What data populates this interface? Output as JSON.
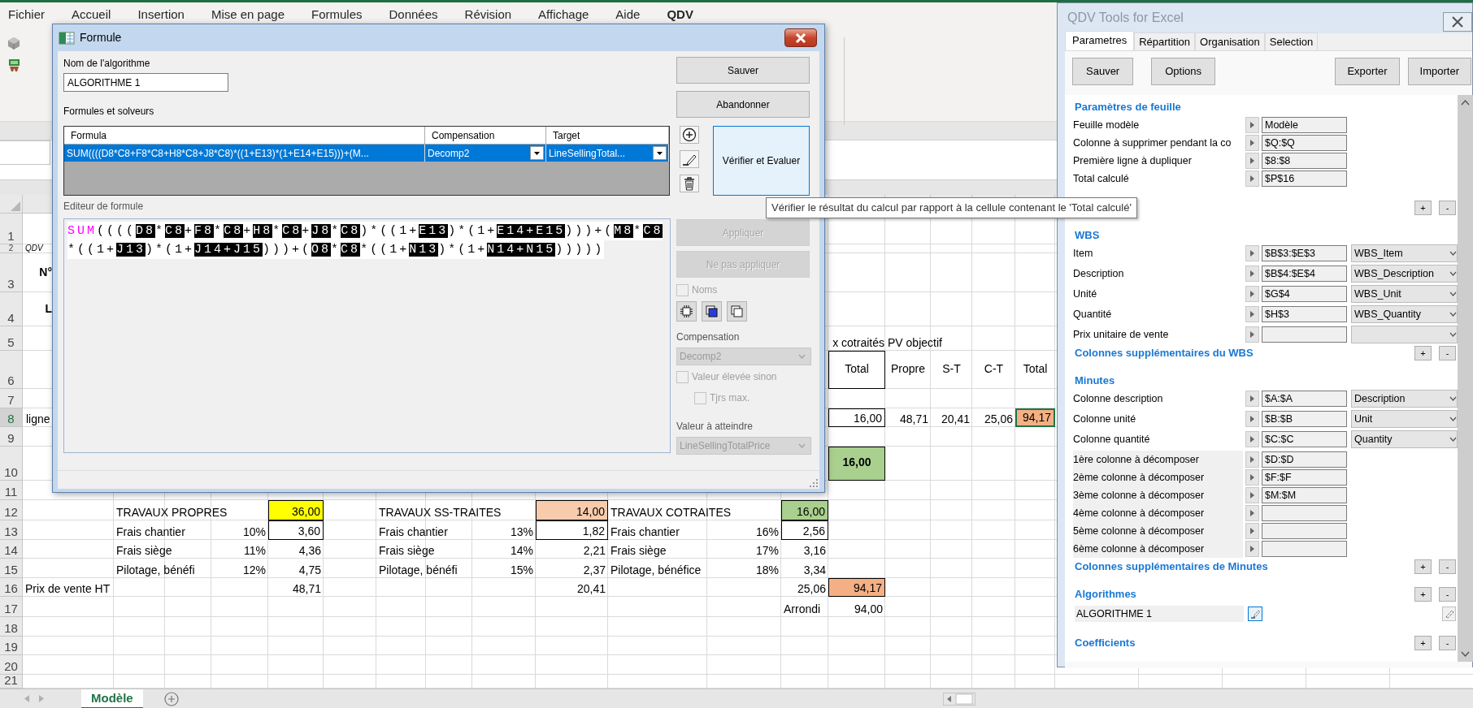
{
  "ribbon": {
    "tabs": [
      {
        "label": "Fichier",
        "selected": false
      },
      {
        "label": "Accueil",
        "selected": false
      },
      {
        "label": "Insertion",
        "selected": false
      },
      {
        "label": "Mise en page",
        "selected": false
      },
      {
        "label": "Formules",
        "selected": false
      },
      {
        "label": "Données",
        "selected": false
      },
      {
        "label": "Révision",
        "selected": false
      },
      {
        "label": "Affichage",
        "selected": false
      },
      {
        "label": "Aide",
        "selected": false
      },
      {
        "label": "QDV",
        "selected": true
      }
    ]
  },
  "sheet": {
    "row_numbers": [
      {
        "label": "1",
        "selected": false
      },
      {
        "label": "2",
        "selected": false
      },
      {
        "label": "3",
        "selected": false
      },
      {
        "label": "4",
        "selected": false
      },
      {
        "label": "5",
        "selected": false
      },
      {
        "label": "6",
        "selected": false
      },
      {
        "label": "7",
        "selected": false
      },
      {
        "label": "8",
        "selected": true
      },
      {
        "label": "9",
        "selected": false
      },
      {
        "label": "10",
        "selected": false
      },
      {
        "label": "11",
        "selected": false
      },
      {
        "label": "12",
        "selected": false
      },
      {
        "label": "13",
        "selected": false
      },
      {
        "label": "14",
        "selected": false
      },
      {
        "label": "15",
        "selected": false
      },
      {
        "label": "16",
        "selected": false
      },
      {
        "label": "17",
        "selected": false
      },
      {
        "label": "18",
        "selected": false
      },
      {
        "label": "19",
        "selected": false
      },
      {
        "label": "20",
        "selected": false
      },
      {
        "label": "21",
        "selected": false
      }
    ],
    "left_strip": [
      {
        "text": "QDV",
        "kind": "note"
      },
      {
        "text": "N°",
        "kind": "cut_bold"
      },
      {
        "text": "L",
        "kind": "cut_bold"
      },
      {
        "text": "ligne",
        "kind": "cut"
      }
    ],
    "objective": {
      "group_label": "x cotraités",
      "label": "PV objectif",
      "headers": [
        "Total",
        "Propre",
        "S-T",
        "C-T",
        "Total"
      ],
      "values": [
        {
          "text": "16,00",
          "selected": false
        },
        {
          "text": "48,71",
          "selected": false
        },
        {
          "text": "20,41",
          "selected": false
        },
        {
          "text": "25,06",
          "selected": false
        },
        {
          "text": "94,17",
          "color": "#f4b084",
          "selected": true
        }
      ],
      "total": {
        "text": "16,00",
        "color": "#a9d08e"
      }
    },
    "blocks": [
      {
        "title": "TRAVAUX PROPRES",
        "amount": {
          "text": "36,00",
          "color": "#ffff00"
        },
        "lines": [
          {
            "label": "Frais chantier",
            "rate": "10%",
            "value": "3,60"
          },
          {
            "label": "Frais siège",
            "rate": "11%",
            "value": "4,36"
          },
          {
            "label": "Pilotage, bénéfi",
            "rate": "12%",
            "value": "4,75"
          }
        ],
        "price": "48,71"
      },
      {
        "title": "TRAVAUX SS-TRAITES",
        "amount": {
          "text": "14,00",
          "color": "#f8cbad"
        },
        "lines": [
          {
            "label": "Frais chantier",
            "rate": "13%",
            "value": "1,82"
          },
          {
            "label": "Frais siège",
            "rate": "14%",
            "value": "2,21"
          },
          {
            "label": "Pilotage, bénéfi",
            "rate": "15%",
            "value": "2,37"
          }
        ],
        "price": "20,41"
      },
      {
        "title": "TRAVAUX COTRAITES",
        "amount": {
          "text": "16,00",
          "color": "#a9d08e"
        },
        "lines": [
          {
            "label": "Frais chantier",
            "rate": "16%",
            "value": "2,56"
          },
          {
            "label": "Frais siège",
            "rate": "17%",
            "value": "3,16"
          },
          {
            "label": "Pilotage, bénéfice",
            "rate": "18%",
            "value": "3,34"
          }
        ],
        "price": "25,06"
      }
    ],
    "price_label": "Prix de vente HT",
    "grand_total": {
      "text": "94,17",
      "color": "#f4b084"
    },
    "rounded": {
      "label": "Arrondi",
      "value": "94,00"
    },
    "sheet_tabs": [
      {
        "label": "Modèle",
        "selected": true
      }
    ]
  },
  "dialog": {
    "title": "Formule",
    "name_label": "Nom de l'algorithme",
    "name_value": "ALGORITHME 1",
    "formulas_label": "Formules et solveurs",
    "formula_grid": {
      "columns": [
        "Formula",
        "Compensation",
        "Target"
      ],
      "rows": [
        {
          "selected": true,
          "formula": "SUM((((D8*C8+F8*C8+H8*C8+J8*C8)*((1+E13)*(1+E14+E15)))+(M...",
          "compensation": "Decomp2",
          "target": "LineSellingTotal..."
        }
      ]
    },
    "actions": [
      {
        "label": "Sauver"
      },
      {
        "label": "Abandonner"
      }
    ],
    "verify_button": {
      "label": "Vérifier et Evaluer",
      "hovered": true
    },
    "editor_label": "Editeur de formule",
    "editor_lines": [
      [
        {
          "kind": "function",
          "text": "SUM"
        },
        {
          "kind": "text",
          "text": "(((("
        },
        {
          "kind": "ref",
          "text": "D8"
        },
        {
          "kind": "text",
          "text": "*"
        },
        {
          "kind": "ref",
          "text": "C8"
        },
        {
          "kind": "text",
          "text": "+"
        },
        {
          "kind": "ref",
          "text": "F8"
        },
        {
          "kind": "text",
          "text": "*"
        },
        {
          "kind": "ref",
          "text": "C8"
        },
        {
          "kind": "text",
          "text": "+"
        },
        {
          "kind": "ref",
          "text": "H8"
        },
        {
          "kind": "text",
          "text": "*"
        },
        {
          "kind": "ref",
          "text": "C8"
        },
        {
          "kind": "text",
          "text": "+"
        },
        {
          "kind": "ref",
          "text": "J8"
        },
        {
          "kind": "text",
          "text": "*"
        },
        {
          "kind": "ref",
          "text": "C8"
        },
        {
          "kind": "text",
          "text": ")*((1+"
        },
        {
          "kind": "ref",
          "text": "E13"
        },
        {
          "kind": "text",
          "text": ")*(1+"
        },
        {
          "kind": "ref",
          "text": "E14+E15"
        },
        {
          "kind": "text",
          "text": ")))+("
        },
        {
          "kind": "ref",
          "text": "M8"
        },
        {
          "kind": "text",
          "text": "*"
        },
        {
          "kind": "ref",
          "text": "C8"
        }
      ],
      [
        {
          "kind": "text",
          "text": "*((1+"
        },
        {
          "kind": "ref",
          "text": "J13"
        },
        {
          "kind": "text",
          "text": ")*(1+"
        },
        {
          "kind": "ref",
          "text": "J14+J15"
        },
        {
          "kind": "text",
          "text": ")))+("
        },
        {
          "kind": "ref",
          "text": "O8"
        },
        {
          "kind": "text",
          "text": "*"
        },
        {
          "kind": "ref",
          "text": "C8"
        },
        {
          "kind": "text",
          "text": "*((1+"
        },
        {
          "kind": "ref",
          "text": "N13"
        },
        {
          "kind": "text",
          "text": ")*(1+"
        },
        {
          "kind": "ref",
          "text": "N14+N15"
        },
        {
          "kind": "text",
          "text": ")))))"
        }
      ]
    ],
    "apply_buttons": [
      {
        "label": "Appliquer",
        "disabled": true
      },
      {
        "label": "Ne pas appliquer",
        "disabled": true
      }
    ],
    "names_option": {
      "label": "Noms",
      "checked": false,
      "disabled": true
    },
    "compensation": {
      "label": "Compensation",
      "value": "Decomp2",
      "disabled": true
    },
    "options": [
      {
        "label": "Valeur élevée sinon",
        "checked": false,
        "disabled": true,
        "children": [
          {
            "label": "Tjrs max.",
            "checked": false,
            "disabled": true
          }
        ]
      }
    ],
    "target": {
      "label": "Valeur à atteindre",
      "value": "LineSellingTotalPrice",
      "disabled": true
    }
  },
  "tooltip": {
    "text": "Vérifier le résultat du calcul par rapport à la cellule contenant le 'Total calculé'"
  },
  "panel": {
    "title": "QDV Tools for Excel",
    "tabs": [
      {
        "label": "Parametres",
        "selected": true
      },
      {
        "label": "Répartition",
        "selected": false
      },
      {
        "label": "Organisation",
        "selected": false
      },
      {
        "label": "Selection",
        "selected": false
      }
    ],
    "left_buttons": [
      {
        "label": "Sauver"
      },
      {
        "label": "Options"
      }
    ],
    "right_buttons": [
      {
        "label": "Exporter"
      },
      {
        "label": "Importer"
      }
    ],
    "sections": [
      {
        "heading": "Paramètres de feuille",
        "rows": [
          {
            "kind": "ref",
            "label": "Feuille modèle",
            "value": "Modèle"
          },
          {
            "kind": "ref",
            "label": "Colonne à supprimer pendant la co",
            "value": "$Q:$Q"
          },
          {
            "kind": "ref",
            "label": "Première ligne à dupliquer",
            "value": "$8:$8"
          },
          {
            "kind": "ref",
            "label": "Total calculé",
            "value": "$P$16"
          }
        ]
      },
      {
        "buttons": [
          "+",
          "-"
        ]
      },
      {
        "heading": "WBS",
        "rows": [
          {
            "kind": "ref_choice",
            "label": "Item",
            "value": "$B$3:$E$3",
            "choice": "WBS_Item"
          },
          {
            "kind": "ref_choice",
            "label": "Description",
            "value": "$B$4:$E$4",
            "choice": "WBS_Description"
          },
          {
            "kind": "ref_choice",
            "label": "Unité",
            "value": "$G$4",
            "choice": "WBS_Unit"
          },
          {
            "kind": "ref_choice",
            "label": "Quantité",
            "value": "$H$3",
            "choice": "WBS_Quantity"
          },
          {
            "kind": "ref_choice",
            "label": "Prix unitaire de vente"
          }
        ]
      },
      {
        "heading": "Colonnes supplémentaires du WBS",
        "buttons": [
          "+",
          "-"
        ]
      },
      {
        "heading": "Minutes",
        "rows": [
          {
            "kind": "ref_choice",
            "label": "Colonne description",
            "value": "$A:$A",
            "choice": "Description"
          },
          {
            "kind": "ref_choice",
            "label": "Colonne unité",
            "value": "$B:$B",
            "choice": "Unit"
          },
          {
            "kind": "ref_choice",
            "label": "Colonne quantité",
            "value": "$C:$C",
            "choice": "Quantity"
          },
          {
            "kind": "decompose",
            "label": "1ère colonne à décomposer",
            "value": "$D:$D"
          },
          {
            "kind": "decompose",
            "label": "2ème colonne à décomposer",
            "value": "$F:$F"
          },
          {
            "kind": "decompose",
            "label": "3ème colonne à décomposer",
            "value": "$M:$M"
          },
          {
            "kind": "decompose",
            "label": "4ème colonne à décomposer"
          },
          {
            "kind": "decompose",
            "label": "5ème colonne à décomposer"
          },
          {
            "kind": "decompose",
            "label": "6ème colonne à décomposer"
          }
        ]
      },
      {
        "heading": "Colonnes supplémentaires de Minutes",
        "buttons": [
          "+",
          "-"
        ]
      },
      {
        "heading": "Algorithmes",
        "buttons": [
          "+",
          "-"
        ],
        "rows": [
          {
            "kind": "algorithm",
            "label": "ALGORITHME 1"
          }
        ]
      },
      {
        "heading": "Coefficients",
        "buttons": [
          "+",
          "-"
        ]
      }
    ]
  }
}
